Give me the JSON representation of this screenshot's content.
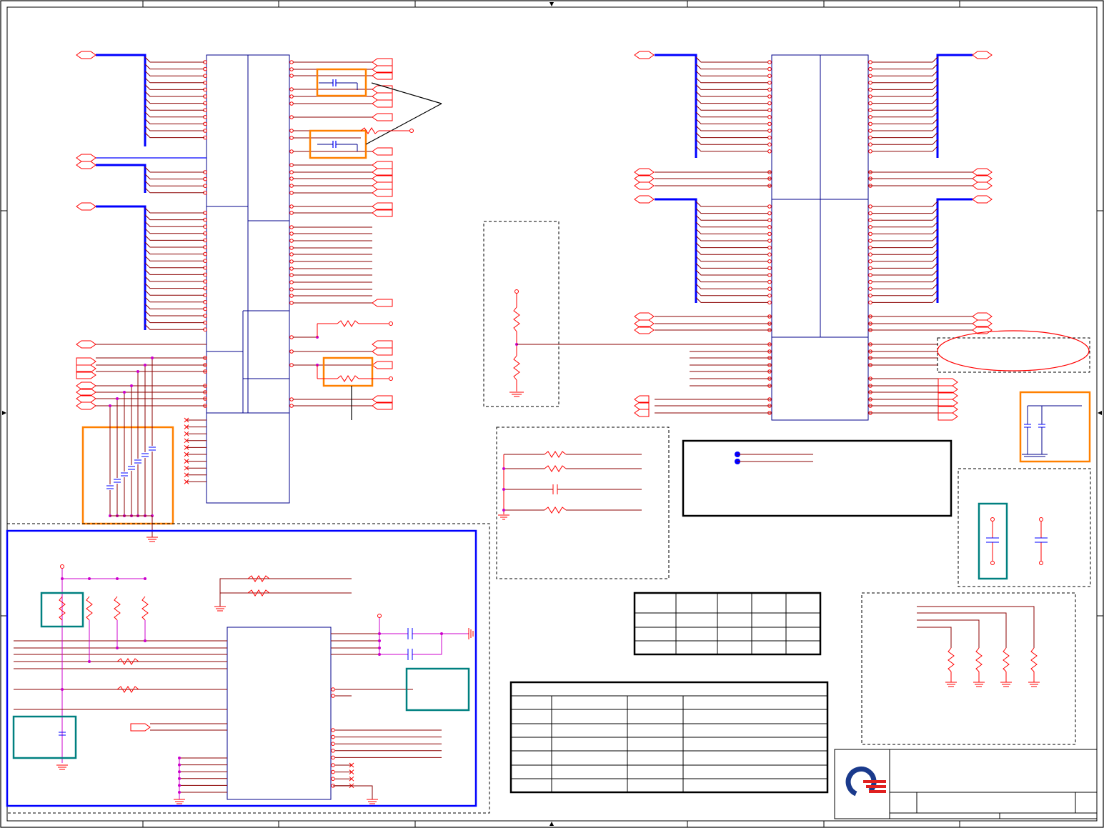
{
  "schematic": {
    "note": "",
    "legend_label_a": "",
    "legend_label_b": ""
  },
  "title_block": {
    "title": "",
    "sheet": ""
  },
  "colors": {
    "sheet_border": "#000000",
    "signal_wire": "#8b0000",
    "bus_wire": "#0000ff",
    "component": "#ff0000",
    "component_alt": "#0000ff",
    "junction": "#cc00cc",
    "highlight_box": "#ff8000",
    "highlight_box_alt": "#008080",
    "logo_primary": "#1a3a8c",
    "logo_accent": "#e02020"
  },
  "icons": [
    "logo-icon",
    "ground-icon",
    "resistor-icon",
    "capacitor-icon",
    "net-label-icon",
    "power-pin-icon",
    "no-connect-icon"
  ]
}
